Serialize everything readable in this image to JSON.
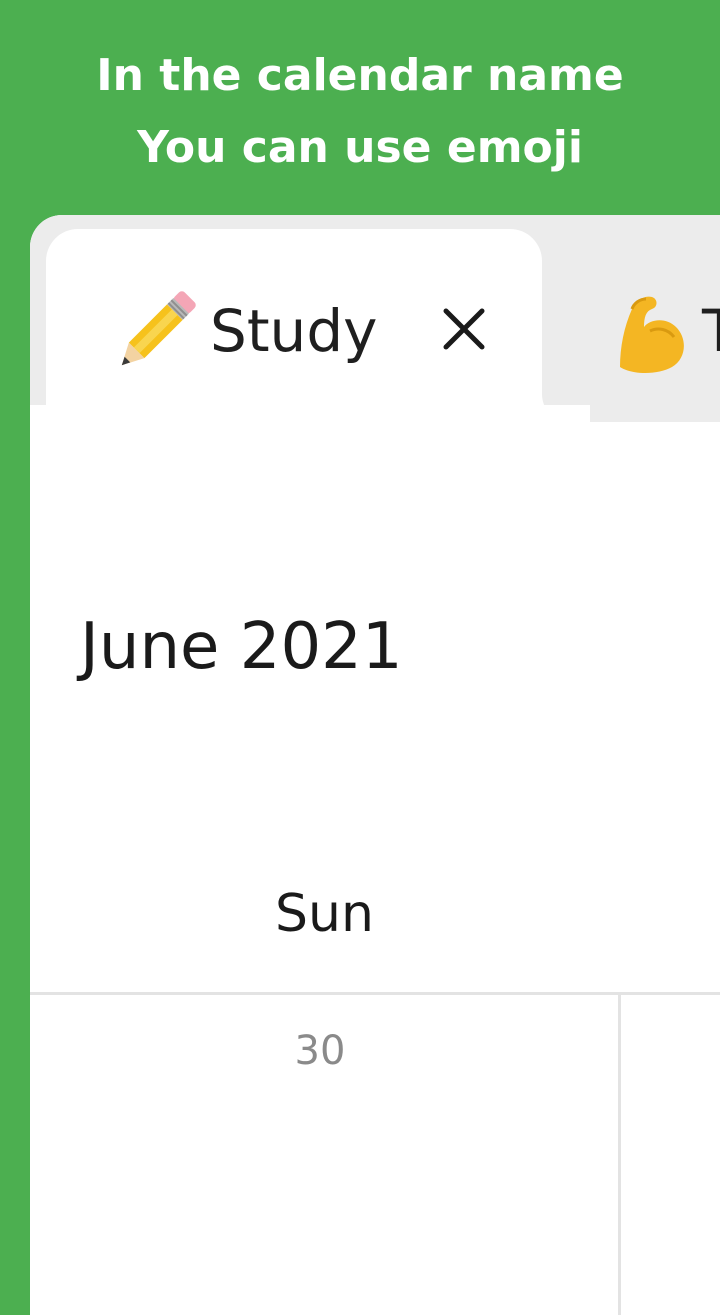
{
  "promo": {
    "line1": "In the calendar name",
    "line2": "You can use emoji",
    "background_color": "#4caf50",
    "text_color": "#ffffff"
  },
  "tabs": [
    {
      "emoji": "pencil-icon",
      "label": "Study",
      "active": true,
      "close_icon": "close-icon"
    },
    {
      "emoji": "flexed-biceps-icon",
      "label": "T",
      "active": false
    }
  ],
  "calendar": {
    "month_title": "June 2021",
    "weekday_headers": [
      "Sun"
    ],
    "days": [
      {
        "number": "30",
        "in_current_month": false
      }
    ]
  },
  "colors": {
    "card_background": "#ffffff",
    "tab_bar_background": "#ececec",
    "grid_line": "#e3e3e3",
    "muted_day_text": "#8a8a8a"
  }
}
